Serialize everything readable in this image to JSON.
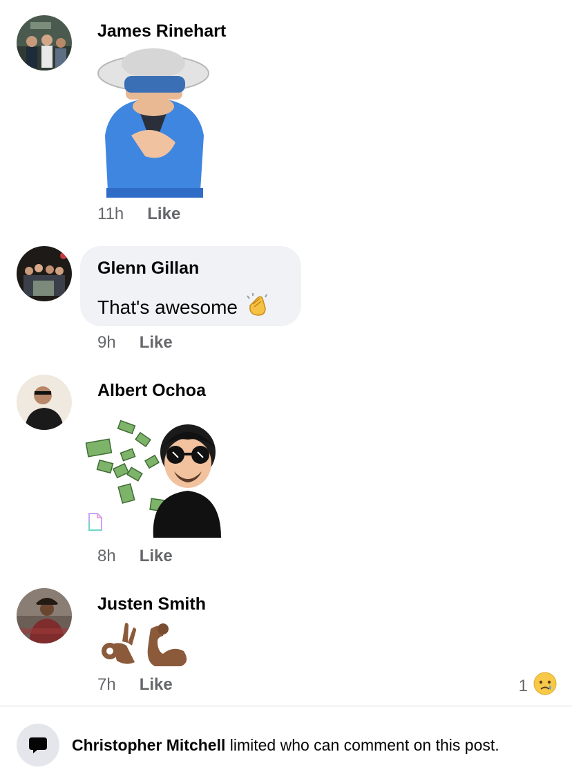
{
  "comments": [
    {
      "name": "James Rinehart",
      "time": "11h",
      "like": "Like"
    },
    {
      "name": "Glenn Gillan",
      "text": "That's awesome",
      "time": "9h",
      "like": "Like"
    },
    {
      "name": "Albert Ochoa",
      "time": "8h",
      "like": "Like"
    },
    {
      "name": "Justen Smith",
      "time": "7h",
      "like": "Like",
      "reaction_count": "1"
    }
  ],
  "notice": {
    "author": "Christopher Mitchell",
    "text": " limited who can comment on this post."
  },
  "colors": {
    "bubble": "#f0f2f5",
    "meta": "#65676b",
    "divider": "#d7d9dd"
  }
}
